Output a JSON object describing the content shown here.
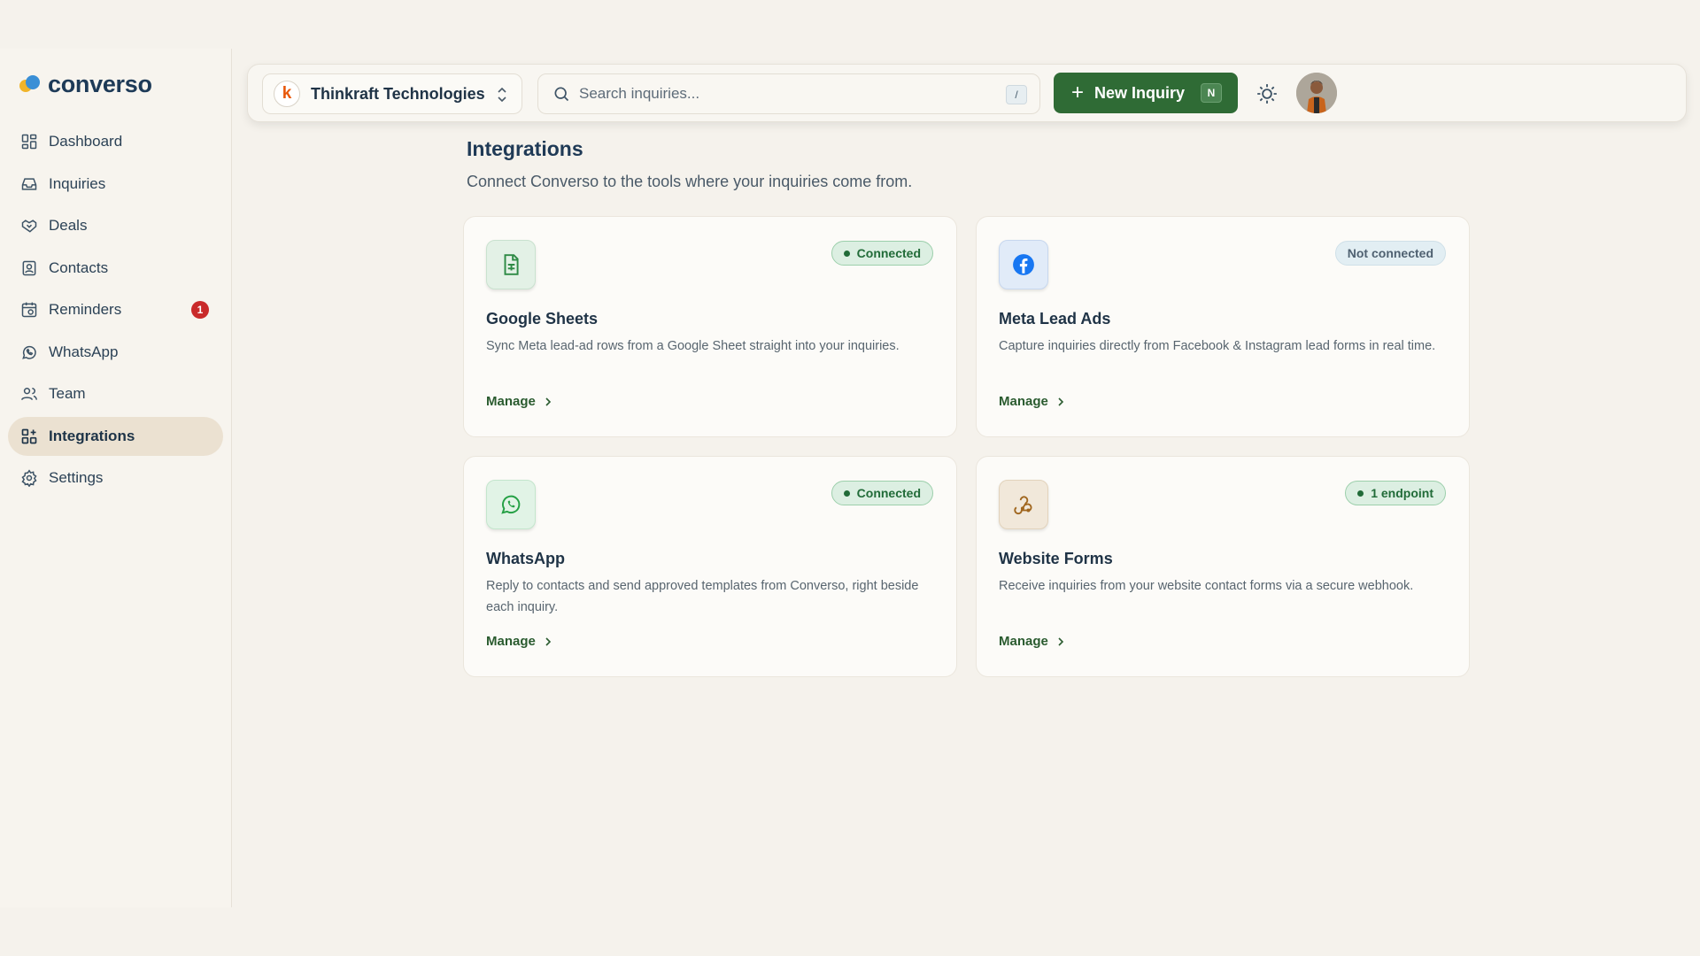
{
  "brand": {
    "name": "converso"
  },
  "sidebar": {
    "items": [
      {
        "label": "Dashboard",
        "icon": "dashboard-icon"
      },
      {
        "label": "Inquiries",
        "icon": "inbox-icon"
      },
      {
        "label": "Deals",
        "icon": "handshake-icon"
      },
      {
        "label": "Contacts",
        "icon": "contacts-icon"
      },
      {
        "label": "Reminders",
        "icon": "alarm-clock-icon",
        "badge": "1"
      },
      {
        "label": "WhatsApp",
        "icon": "whatsapp-icon"
      },
      {
        "label": "Team",
        "icon": "users-icon"
      },
      {
        "label": "Integrations",
        "icon": "integrations-icon",
        "active": true
      },
      {
        "label": "Settings",
        "icon": "gear-icon"
      }
    ]
  },
  "topbar": {
    "org_initial": "k",
    "org_name": "Thinkraft Technologies",
    "search_placeholder": "Search inquiries...",
    "search_shortcut": "/",
    "new_button_label": "New Inquiry",
    "new_button_shortcut": "N"
  },
  "page": {
    "title": "Integrations",
    "subtitle": "Connect Converso to the tools where your inquiries come from."
  },
  "cards": [
    {
      "title": "Google Sheets",
      "description": "Sync Meta lead-ad rows from a Google Sheet straight into your inquiries.",
      "status": "Connected",
      "manage": "Manage",
      "icon": "spreadsheet-icon"
    },
    {
      "title": "Meta Lead Ads",
      "description": "Capture inquiries directly from Facebook & Instagram lead forms in real time.",
      "status": "Not connected",
      "manage": "Manage",
      "icon": "facebook-icon"
    },
    {
      "title": "WhatsApp",
      "description": "Reply to contacts and send approved templates from Converso, right beside each inquiry.",
      "status": "Connected",
      "manage": "Manage",
      "icon": "whatsapp-icon"
    },
    {
      "title": "Website Forms",
      "description": "Receive inquiries from your website contact forms via a secure webhook.",
      "status": "1 endpoint",
      "manage": "Manage",
      "icon": "webhook-icon"
    }
  ],
  "colors": {
    "accent_green": "#2f6b35",
    "active_nav_bg": "#ebe1d1",
    "badge_red": "#c92a2a",
    "connected_green": "#216b38"
  }
}
